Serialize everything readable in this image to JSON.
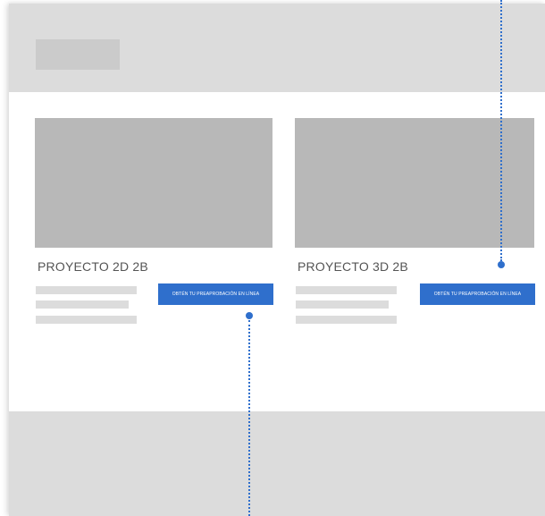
{
  "cards": [
    {
      "title": "PROYECTO 2D 2B",
      "cta_label": "OBTÉN TU PREAPROBACIÓN EN LÍNEA"
    },
    {
      "title": "PROYECTO 3D 2B",
      "cta_label": "OBTÉN TU PREAPROBACIÓN EN LÍNEA"
    }
  ],
  "colors": {
    "accent": "#2f6fcc",
    "placeholder_light": "#dcdcdc",
    "placeholder_dark": "#b8b8b8",
    "title_text": "#555555"
  }
}
